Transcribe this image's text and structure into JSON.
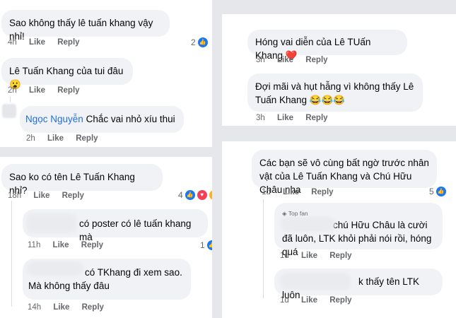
{
  "labels": {
    "like": "Like",
    "reply": "Reply"
  },
  "panel_a": {
    "c1": {
      "text": "Sao không thấy lê tuấn khang vậy nhỉ!",
      "time": "4h",
      "reactions": "2"
    },
    "c2": {
      "text": "Lê Tuấn Khang của tui đâu 😮",
      "time": "2h"
    },
    "c3": {
      "author": "Ngọc Nguyễn",
      "text": "Chắc vai nhỏ xíu thui",
      "time": "2h"
    }
  },
  "panel_b": {
    "c1": {
      "text": "Hóng vai diễn của Lê TUấn Khang ❤️",
      "time": "3h"
    },
    "c2": {
      "text": "Đợi mãi và hụt hẫng vì không thấy Lê Tuấn Khang 😂😂😂",
      "time": "3h"
    }
  },
  "panel_c": {
    "c1": {
      "text": "Sao ko có tên Lê Tuấn Khang nhỉ?",
      "time": "18h",
      "reactions": "4"
    },
    "r1": {
      "text": "có poster có lê tuấn khang mà",
      "time": "11h",
      "reactions": "1"
    },
    "r2": {
      "text": "có TKhang đi xem sao. Mà không thấy đâu",
      "time": "14h"
    }
  },
  "panel_d": {
    "c1": {
      "text": "Các bạn sẽ vô cùng bất ngờ trước nhân vật của Lê Tuấn Khang và Chú Hữu Châu nha",
      "time": "1d",
      "reactions": "5"
    },
    "r1": {
      "badge": "Top fan",
      "text": "chú Hữu Châu là cười đã luôn, LTK khỏi phải nói rồi, hóng quá",
      "time": "1d"
    },
    "r2": {
      "text": "k thấy tên LTK luôn",
      "time": "1d"
    }
  }
}
